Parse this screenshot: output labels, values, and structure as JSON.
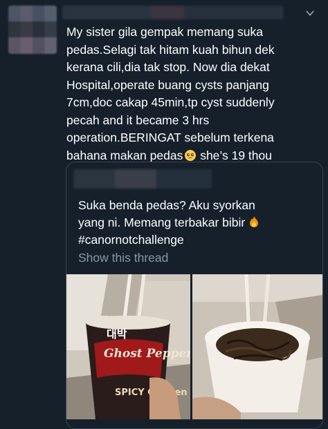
{
  "tweet": {
    "text": "My sister gila gempak memang suka\npedas.Selagi tak hitam kuah bihun dek\nkerana cili,dia tak stop. Now dia dekat\nHospital,operate buang cysts panjang\n7cm,doc cakap 45min,tp cyst suddenly\npecah and it became 3 hrs\noperation.BERINGAT sebelum terkena\nbahana makan pedas",
    "text_tail": " she’s 19 thou",
    "emoji_icon": "pleading-face-emoji"
  },
  "quote": {
    "text": "Suka benda pedas? Aku syorkan\nyang ni. Memang terbakar bibir ",
    "hashtag": "#canornotchallenge",
    "emoji_icon": "fire-emoji",
    "show_thread": "Show this thread",
    "cup_text_top": "대박",
    "cup_text_mid": "Ghost Pepper",
    "cup_text_bottom": "SPICY Chicken"
  },
  "colors": {
    "background": "#15202b",
    "border": "#38444d",
    "secondary_text": "#8899a6"
  }
}
